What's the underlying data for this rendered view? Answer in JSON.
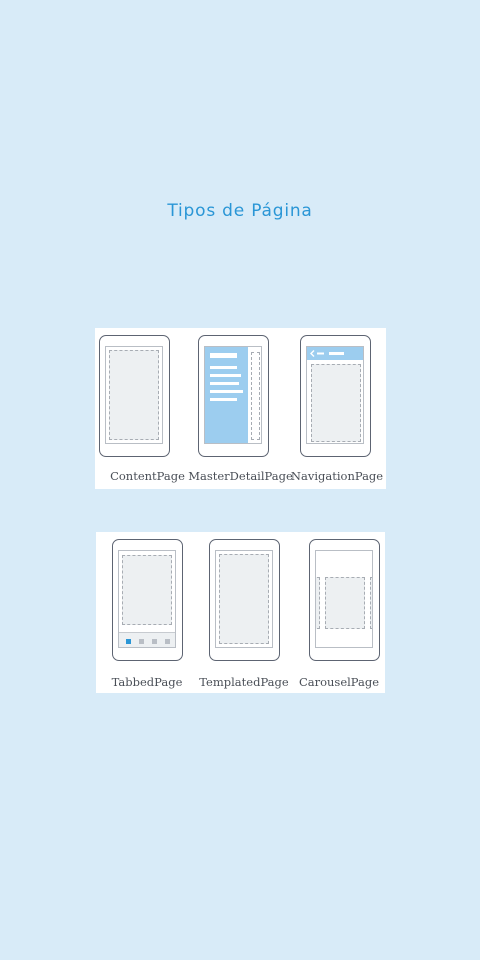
{
  "title": "Tipos de Página",
  "page_types": [
    {
      "label": "ContentPage"
    },
    {
      "label": "MasterDetailPage"
    },
    {
      "label": "NavigationPage"
    },
    {
      "label": "TabbedPage"
    },
    {
      "label": "TemplatedPage"
    },
    {
      "label": "CarouselPage"
    }
  ],
  "colors": {
    "background": "#d8ebf8",
    "accent": "#2a96d6",
    "master_panel": "#9ccdef",
    "phone_outline": "#5d6472",
    "placeholder": "#edf0f2"
  },
  "icons": {
    "navigation_back": "chevron-left-icon"
  }
}
